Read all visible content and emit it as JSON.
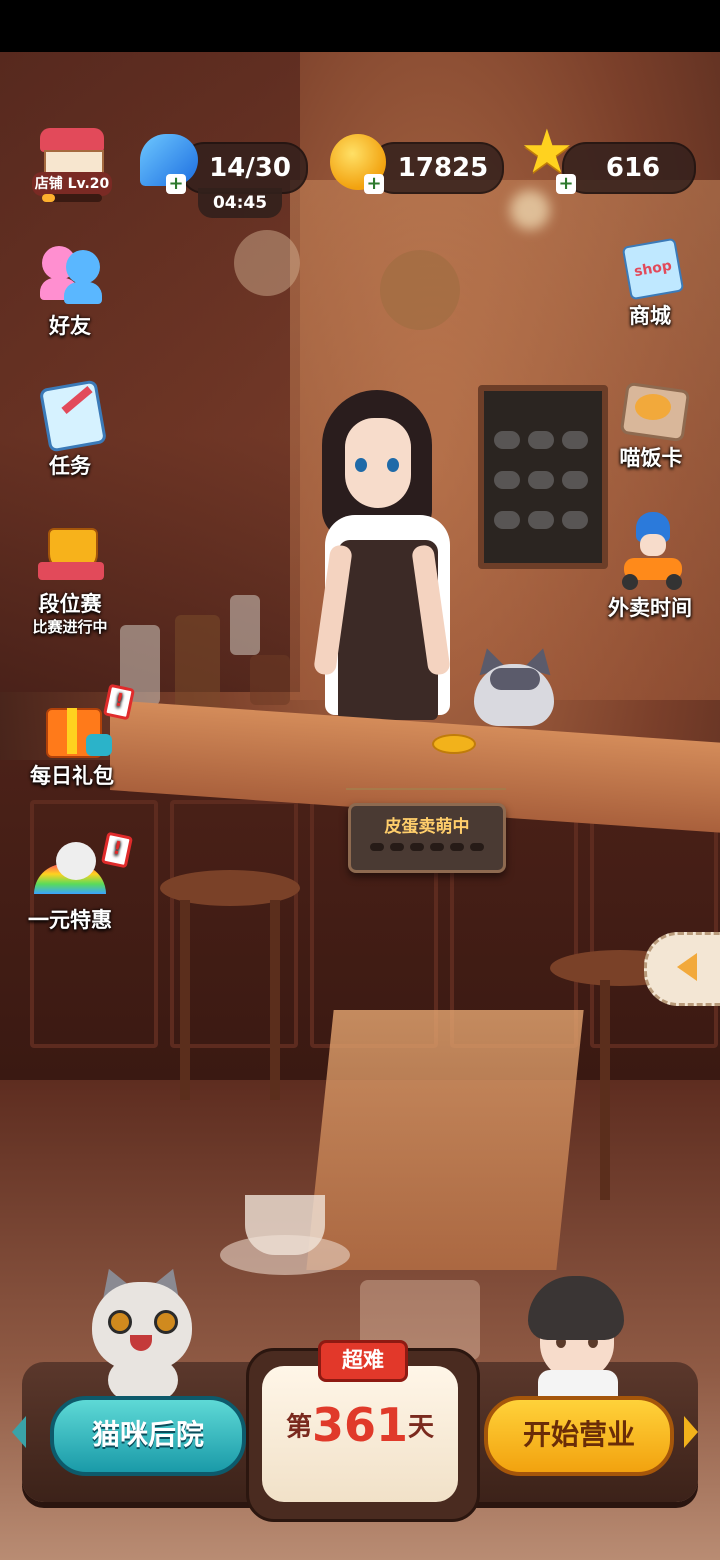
{
  "hud": {
    "store_level": "店铺 Lv.20",
    "store_progress": 0.22,
    "energy": "14/30",
    "energy_timer": "04:45",
    "coins": "17825",
    "stars": "616"
  },
  "left_menu": [
    {
      "label": "好友"
    },
    {
      "label": "任务"
    },
    {
      "label": "段位赛",
      "sub": "比赛进行中"
    },
    {
      "label": "每日礼包",
      "badge": "!"
    },
    {
      "label": "一元特惠",
      "badge": "!"
    }
  ],
  "right_menu": [
    {
      "label": "商城",
      "icon_text": "shop"
    },
    {
      "label": "喵饭卡"
    },
    {
      "label": "外卖时间"
    }
  ],
  "scene": {
    "sign_text": "皮蛋卖萌中"
  },
  "bottom": {
    "left_button": "猫咪后院",
    "right_button": "开始营业",
    "difficulty": "超难",
    "day_prefix": "第",
    "day_number": "361",
    "day_suffix": "天"
  },
  "colors": {
    "accent_teal": "#1a9aa8",
    "accent_gold": "#f2a20f",
    "badge_red": "#e02b2b"
  }
}
